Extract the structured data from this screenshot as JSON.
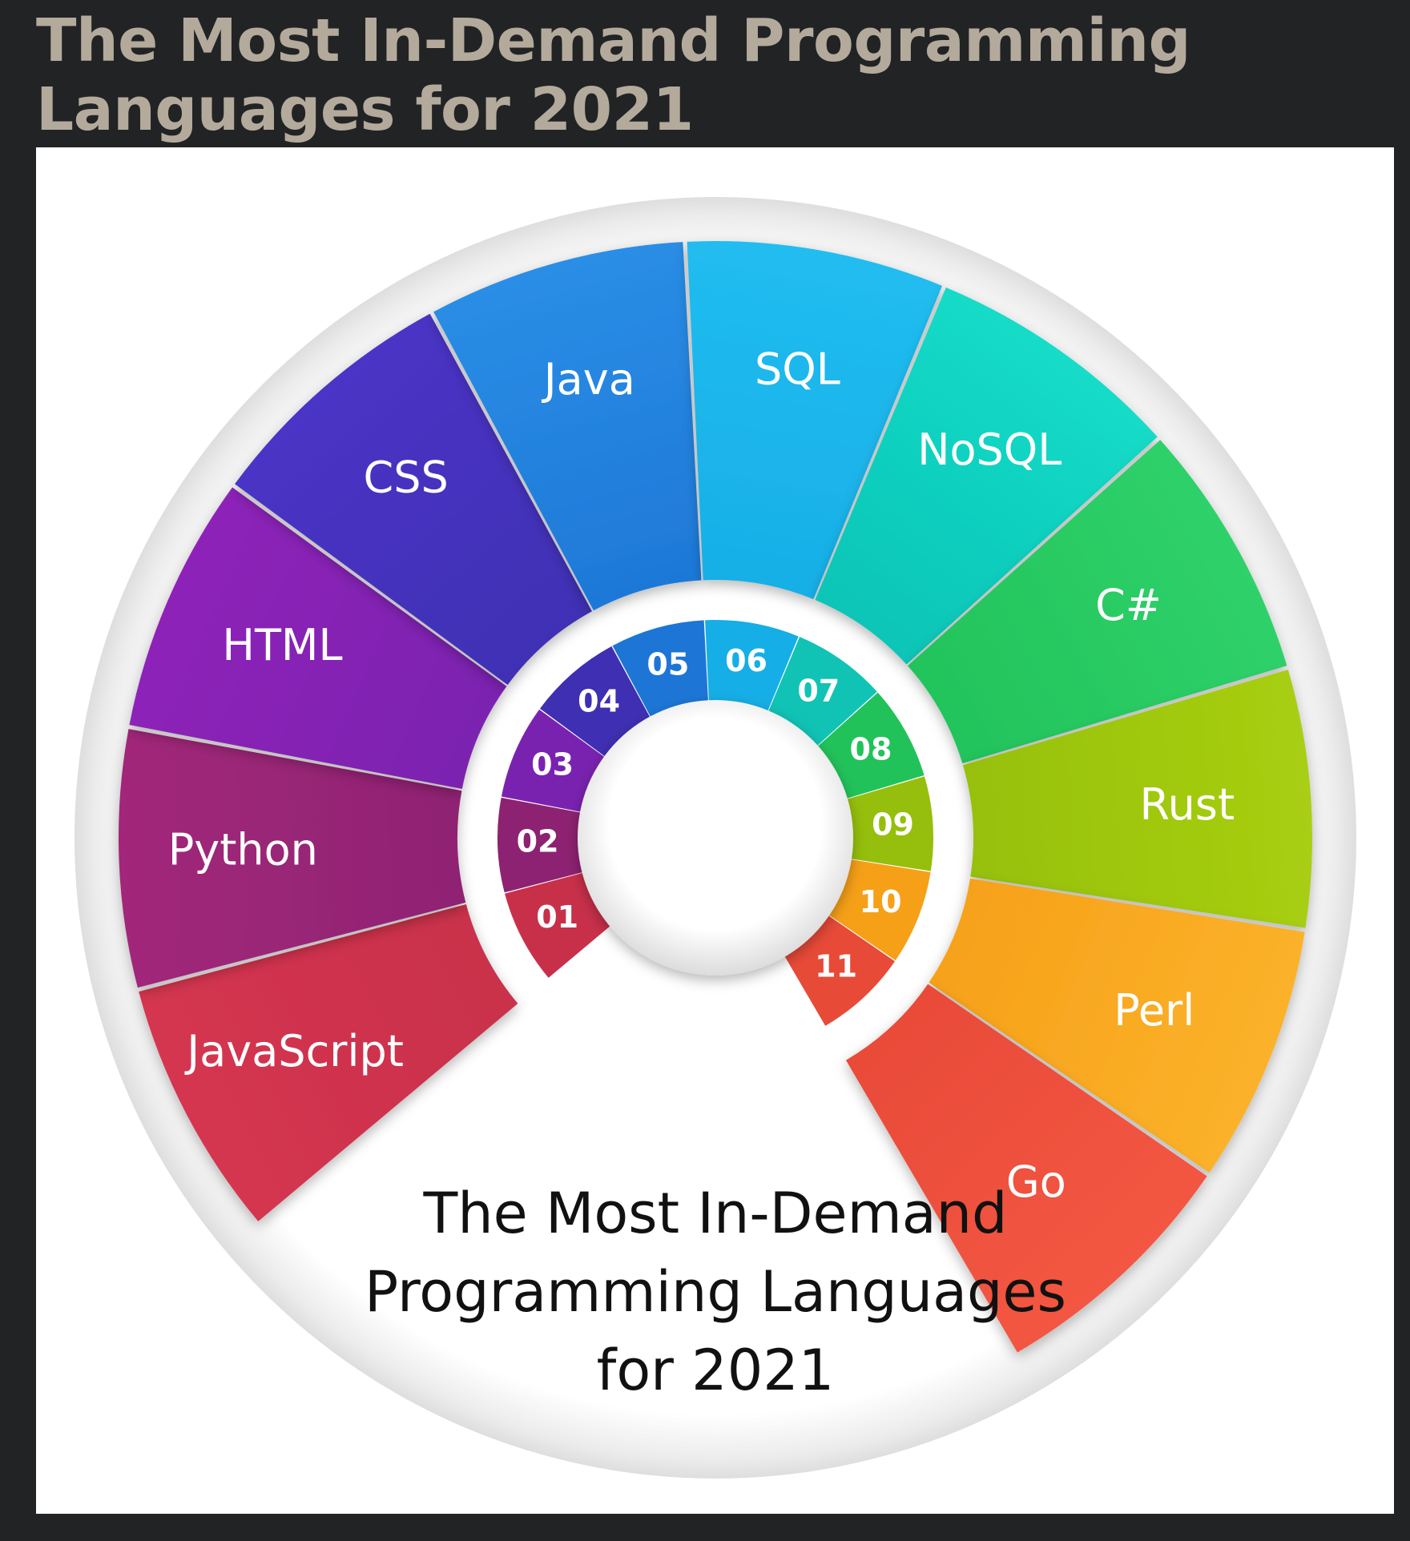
{
  "page": {
    "title": "The Most In-Demand Programming Languages for 2021"
  },
  "infographic": {
    "center_title_lines": [
      "The Most In-Demand",
      "Programming Languages",
      "for 2021"
    ],
    "segments": [
      {
        "number": "01",
        "name": "JavaScript",
        "color": "#d53550",
        "color_dark": "#c8304a"
      },
      {
        "number": "02",
        "name": "Python",
        "color": "#a2287a",
        "color_dark": "#8e2272"
      },
      {
        "number": "03",
        "name": "HTML",
        "color": "#8e24b8",
        "color_dark": "#7a22b0"
      },
      {
        "number": "04",
        "name": "CSS",
        "color": "#4a34c6",
        "color_dark": "#3f2fb3"
      },
      {
        "number": "05",
        "name": "Java",
        "color": "#2a8ee6",
        "color_dark": "#1d76d6"
      },
      {
        "number": "06",
        "name": "SQL",
        "color": "#21bdf0",
        "color_dark": "#16aee6"
      },
      {
        "number": "07",
        "name": "NoSQL",
        "color": "#12dcc8",
        "color_dark": "#10c3b5"
      },
      {
        "number": "08",
        "name": "C#",
        "color": "#2fd16a",
        "color_dark": "#22c25a"
      },
      {
        "number": "09",
        "name": "Rust",
        "color": "#a8cf12",
        "color_dark": "#95bf0c"
      },
      {
        "number": "10",
        "name": "Perl",
        "color": "#fbb22a",
        "color_dark": "#f6a018"
      },
      {
        "number": "11",
        "name": "Go",
        "color": "#f35642",
        "color_dark": "#e84a38"
      }
    ]
  }
}
